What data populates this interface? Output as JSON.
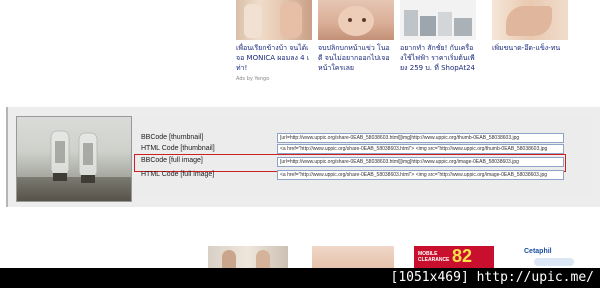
{
  "top_ads": [
    {
      "text": "เพื่อนเรียกข้างบ้า จนได้เจอ MONICA ผอมลง 4 เท่า!"
    },
    {
      "text": "จบปลิกบกหน้าแข่ว โนอดี จนไม่อยากออกไปเจอหน้าใครเลย"
    },
    {
      "text": "อยากทำ สักชั่ย! กับเครื่องใช้ไฟฟ้า ราคาเริ่มต้นเพียง 259 บ. ที่ ShopAt24"
    },
    {
      "text": "เพิ่มขนาด-อึด-แข็ง-ทน"
    }
  ],
  "ads_by": "Ads by Yengo",
  "codes": {
    "bbcode_thumb": {
      "label": "BBCode [thumbnail]",
      "value": "[url=http://www.uppic.org/share-0EAB_58038603.html][img]http://www.uppic.org/thumb-0EAB_58038603.jpg"
    },
    "html_thumb": {
      "label": "HTML Code [thumbnail]",
      "value": "<a href=\"http://www.uppic.org/share-0EAB_58038603.html\"> <img src=\"http://www.uppic.org/thumb-0EAB_58038603.jpg"
    },
    "bbcode_full": {
      "label": "BBCode [full image]",
      "value": "[url=http://www.uppic.org/share-0EAB_58038603.html][img]http://www.uppic.org/image-0EAB_58038603.jpg"
    },
    "html_full": {
      "label": "HTML Code [full image]",
      "value": "<a href=\"http://www.uppic.org/share-0EAB_58038603.html\"> <img src=\"http://www.uppic.org/image-0EAB_58038603.jpg"
    }
  },
  "bottom_ads": {
    "ad3_line1": "MOBILE",
    "ad3_line2": "CLEARANCE",
    "ad3_number": "82",
    "ad4_text": "Cetaphil"
  },
  "footer": {
    "text": "[1051x469] http://upic.me/"
  },
  "colors": {
    "highlight": "#cc2020",
    "panel_bg": "#ededed",
    "footer_bg": "#000000",
    "ad_text": "#1a2a7a"
  }
}
